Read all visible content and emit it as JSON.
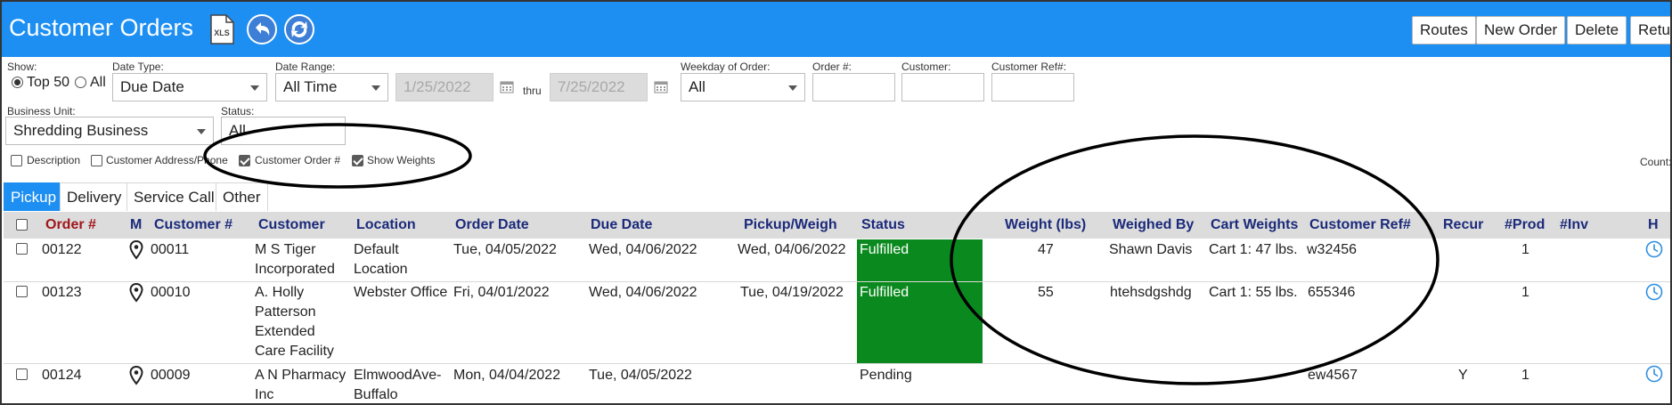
{
  "header": {
    "title": "Customer Orders",
    "buttons": {
      "routes": "Routes",
      "new_order": "New Order",
      "delete": "Delete",
      "return": "Return"
    },
    "accent": "#1e8ff2"
  },
  "filters": {
    "show_label": "Show:",
    "show_top50": "Top 50",
    "show_all": "All",
    "date_type_label": "Date Type:",
    "date_type_value": "Due Date",
    "date_range_label": "Date Range:",
    "date_range_value": "All Time",
    "date_from": "1/25/2022",
    "thru": "thru",
    "date_to": "7/25/2022",
    "weekday_label": "Weekday of Order:",
    "weekday_value": "All",
    "order_no_label": "Order #:",
    "customer_label": "Customer:",
    "customer_ref_label": "Customer Ref#:",
    "business_unit_label": "Business Unit:",
    "business_unit_value": "Shredding Business",
    "status_label": "Status:",
    "status_value": "All",
    "options": {
      "description": "Description",
      "customer_address": "Customer Address/Phone",
      "customer_order": "Customer Order #",
      "show_weights": "Show Weights"
    },
    "count_label": "Count:"
  },
  "tabs": [
    "Pickup",
    "Delivery",
    "Service Call",
    "Other"
  ],
  "columns": {
    "order": "Order #",
    "m": "M",
    "customer_no": "Customer #",
    "customer": "Customer",
    "location": "Location",
    "order_date": "Order Date",
    "due_date": "Due Date",
    "pickup_weigh": "Pickup/Weigh",
    "status": "Status",
    "weight": "Weight (lbs)",
    "weighed_by": "Weighed By",
    "cart_weights": "Cart Weights",
    "customer_ref": "Customer Ref#",
    "recur": "Recur",
    "prod": "#Prod",
    "inv": "#Inv",
    "h": "H"
  },
  "rows": [
    {
      "order": "00122",
      "customer_no": "00011",
      "customer": "M S Tiger Incorporated",
      "location": "Default Location",
      "order_date": "Tue, 04/05/2022",
      "due_date": "Wed, 04/06/2022",
      "pickup_weigh": "Wed, 04/06/2022",
      "status": "Fulfilled",
      "weight": "47",
      "weighed_by": "Shawn Davis",
      "cart_weights": "Cart 1: 47 lbs.",
      "customer_ref": "w32456",
      "recur": "",
      "prod": "1",
      "inv": ""
    },
    {
      "order": "00123",
      "customer_no": "00010",
      "customer": "A. Holly Patterson Extended Care Facility",
      "location": "Webster Office",
      "order_date": "Fri, 04/01/2022",
      "due_date": "Wed, 04/06/2022",
      "pickup_weigh": "Tue, 04/19/2022",
      "status": "Fulfilled",
      "weight": "55",
      "weighed_by": "htehsdgshdg",
      "cart_weights": "Cart 1: 55 lbs.",
      "customer_ref": "655346",
      "recur": "",
      "prod": "1",
      "inv": ""
    },
    {
      "order": "00124",
      "customer_no": "00009",
      "customer": "A N Pharmacy Inc",
      "location": "ElmwoodAve-Buffalo",
      "order_date": "Mon, 04/04/2022",
      "due_date": "Tue, 04/05/2022",
      "pickup_weigh": "",
      "status": "Pending",
      "weight": "",
      "weighed_by": "",
      "cart_weights": "",
      "customer_ref": "ew4567",
      "recur": "Y",
      "prod": "1",
      "inv": ""
    }
  ]
}
